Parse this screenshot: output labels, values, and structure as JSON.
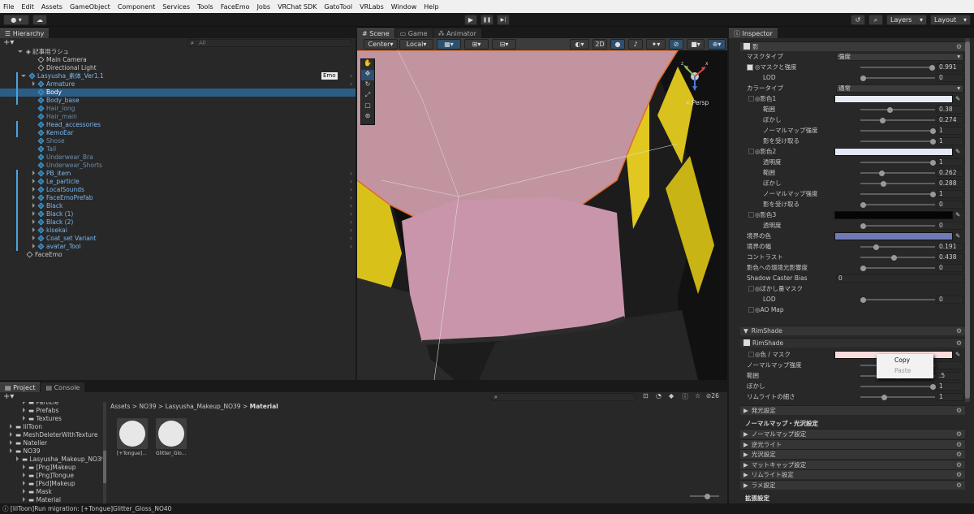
{
  "menu": [
    "File",
    "Edit",
    "Assets",
    "GameObject",
    "Component",
    "Services",
    "Tools",
    "FaceEmo",
    "Jobs",
    "VRChat SDK",
    "GatoTool",
    "VRLabs",
    "Window",
    "Help"
  ],
  "toolbar": {
    "account": "●",
    "layers": "Layers",
    "layout": "Layout",
    "play": "▶",
    "pause": "❚❚",
    "step": "▶|"
  },
  "hierarchy": {
    "tab": "Hierarchy",
    "search_placeholder": "All",
    "scene": "記事用ラシュ",
    "emo_badge": "Emo",
    "items": [
      {
        "label": "Main Camera",
        "indent": 2,
        "style": "normal",
        "icon": "gameobject"
      },
      {
        "label": "Directional Light",
        "indent": 2,
        "style": "normal",
        "icon": "gameobject"
      },
      {
        "label": "Lasyusha_素体_Ver1.1",
        "indent": 1,
        "style": "blue",
        "icon": "prefab",
        "fold": "open"
      },
      {
        "label": "Armature",
        "indent": 2,
        "style": "blue",
        "icon": "prefab",
        "fold": "closed"
      },
      {
        "label": "Body",
        "indent": 2,
        "style": "selected",
        "icon": "prefab"
      },
      {
        "label": "Body_base",
        "indent": 2,
        "style": "blue",
        "icon": "prefab"
      },
      {
        "label": "Hair_long",
        "indent": 2,
        "style": "dim",
        "icon": "prefab"
      },
      {
        "label": "Hair_main",
        "indent": 2,
        "style": "dim",
        "icon": "prefab"
      },
      {
        "label": "Head_accessories",
        "indent": 2,
        "style": "blue",
        "icon": "prefab"
      },
      {
        "label": "KemoEar",
        "indent": 2,
        "style": "blue",
        "icon": "prefab"
      },
      {
        "label": "Shose",
        "indent": 2,
        "style": "dim",
        "icon": "prefab"
      },
      {
        "label": "Tail",
        "indent": 2,
        "style": "dim",
        "icon": "prefab"
      },
      {
        "label": "Underwear_Bra",
        "indent": 2,
        "style": "dim",
        "icon": "prefab"
      },
      {
        "label": "Underwear_Shorts",
        "indent": 2,
        "style": "dim",
        "icon": "prefab"
      },
      {
        "label": "PB_item",
        "indent": 2,
        "style": "blue",
        "icon": "prefab",
        "fold": "closed"
      },
      {
        "label": "Le_particle",
        "indent": 2,
        "style": "blue",
        "icon": "prefab",
        "fold": "closed"
      },
      {
        "label": "LocalSounds",
        "indent": 2,
        "style": "blue",
        "icon": "prefab",
        "fold": "closed"
      },
      {
        "label": "FaceEmoPrefab",
        "indent": 2,
        "style": "blue",
        "icon": "prefab",
        "fold": "closed"
      },
      {
        "label": "Black",
        "indent": 2,
        "style": "blue",
        "icon": "prefab",
        "fold": "closed"
      },
      {
        "label": "Black (1)",
        "indent": 2,
        "style": "blue",
        "icon": "prefab",
        "fold": "closed"
      },
      {
        "label": "Black (2)",
        "indent": 2,
        "style": "blue",
        "icon": "prefab",
        "fold": "closed"
      },
      {
        "label": "kisekai",
        "indent": 2,
        "style": "blue",
        "icon": "prefab",
        "fold": "closed"
      },
      {
        "label": "Coat_set Variant",
        "indent": 2,
        "style": "blue",
        "icon": "prefab",
        "fold": "closed"
      },
      {
        "label": "avatar_Tool",
        "indent": 2,
        "style": "blue",
        "icon": "prefab",
        "fold": "closed"
      },
      {
        "label": "FaceEmo",
        "indent": 1,
        "style": "normal",
        "icon": "gameobject"
      }
    ]
  },
  "scene": {
    "tabs": [
      "Scene",
      "Game",
      "Animator"
    ],
    "pivot": "Center",
    "space": "Local",
    "mode_2d": "2D",
    "persp": "< Persp",
    "gizmo_axes": {
      "x": "x",
      "y": "y",
      "z": "z"
    }
  },
  "project": {
    "tabs": [
      "Project",
      "Console"
    ],
    "breadcrumb": [
      "Assets",
      "NO39",
      "Lasyusha_Makeup_NO39",
      "Material"
    ],
    "hidden_count": "26",
    "tree": [
      {
        "label": "Particle",
        "indent": 3
      },
      {
        "label": "Prefabs",
        "indent": 3
      },
      {
        "label": "Textures",
        "indent": 3
      },
      {
        "label": "lilToon",
        "indent": 1
      },
      {
        "label": "MeshDeleterWithTexture",
        "indent": 1
      },
      {
        "label": "Natelier",
        "indent": 1
      },
      {
        "label": "NO39",
        "indent": 1
      },
      {
        "label": "Lasyusha_Makeup_NO39",
        "indent": 2
      },
      {
        "label": "[Png]Makeup",
        "indent": 3
      },
      {
        "label": "[Png]Tongue",
        "indent": 3
      },
      {
        "label": "[Psd]Makeup",
        "indent": 3
      },
      {
        "label": "Mask",
        "indent": 3
      },
      {
        "label": "Material",
        "indent": 3
      }
    ],
    "assets": [
      "[+Tongue]...",
      "Glitter_Glo..."
    ]
  },
  "status": "[lilToon]Run migration: [+Tongue]Glitter_Gloss_NO40",
  "inspector": {
    "tab": "Inspector",
    "header": "影",
    "rows": [
      {
        "label": "マスクタイプ",
        "type": "dropdown",
        "value": "強度",
        "indent": 0
      },
      {
        "label": "◎マスクと強度",
        "type": "slider",
        "value": "0.991",
        "frac": 0.991,
        "indent": 1,
        "tex": true
      },
      {
        "label": "LOD",
        "type": "slider",
        "value": "0",
        "frac": 0,
        "indent": 2
      },
      {
        "label": "カラータイプ",
        "type": "dropdown",
        "value": "通常",
        "indent": 0
      },
      {
        "label": "◎影色1",
        "type": "color",
        "color": "#e7ebf7",
        "indent": 1
      },
      {
        "label": "範囲",
        "type": "slider",
        "value": "0.38",
        "frac": 0.38,
        "indent": 2
      },
      {
        "label": "ぼかし",
        "type": "slider",
        "value": "0.274",
        "frac": 0.274,
        "indent": 2
      },
      {
        "label": "ノーマルマップ強度",
        "type": "slider",
        "value": "1",
        "frac": 1,
        "indent": 2
      },
      {
        "label": "影を受け取る",
        "type": "slider",
        "value": "1",
        "frac": 1,
        "indent": 2
      },
      {
        "label": "◎影色2",
        "type": "color",
        "color": "#e3e7f8",
        "indent": 1
      },
      {
        "label": "透明度",
        "type": "slider",
        "value": "1",
        "frac": 1,
        "indent": 2
      },
      {
        "label": "範囲",
        "type": "slider",
        "value": "0.262",
        "frac": 0.262,
        "indent": 2
      },
      {
        "label": "ぼかし",
        "type": "slider",
        "value": "0.288",
        "frac": 0.288,
        "indent": 2
      },
      {
        "label": "ノーマルマップ強度",
        "type": "slider",
        "value": "1",
        "frac": 1,
        "indent": 2
      },
      {
        "label": "影を受け取る",
        "type": "slider",
        "value": "0",
        "frac": 0,
        "indent": 2
      },
      {
        "label": "◎影色3",
        "type": "color",
        "color": "#050505",
        "indent": 1
      },
      {
        "label": "透明度",
        "type": "slider",
        "value": "0",
        "frac": 0,
        "indent": 2
      },
      {
        "label": "境界の色",
        "type": "color",
        "color": "#6f7ab5",
        "indent": 0
      },
      {
        "label": "境界の幅",
        "type": "slider",
        "value": "0.191",
        "frac": 0.191,
        "indent": 0
      },
      {
        "label": "コントラスト",
        "type": "slider",
        "value": "0.438",
        "frac": 0.438,
        "indent": 0
      },
      {
        "label": "影色への環境光影響度",
        "type": "slider",
        "value": "0",
        "frac": 0,
        "indent": 0
      },
      {
        "label": "Shadow Caster Bias",
        "type": "field",
        "value": "0",
        "indent": 0
      },
      {
        "label": "◎ぼかし量マスク",
        "type": "none",
        "indent": 1
      },
      {
        "label": "LOD",
        "type": "slider",
        "value": "0",
        "frac": 0,
        "indent": 2
      },
      {
        "label": "◎AO Map",
        "type": "none",
        "indent": 1
      }
    ],
    "rimshade_section": "RimShade",
    "rimshade_toggle": "RimShade",
    "rim_rows": [
      {
        "label": "◎色 / マスク",
        "type": "color",
        "color": "#fbdcdc",
        "indent": 1
      },
      {
        "label": "ノーマルマップ強度",
        "type": "slider",
        "value": "",
        "frac": 0.9,
        "indent": 0
      },
      {
        "label": "範囲",
        "type": "slider",
        "value": ".5",
        "frac": 0.5,
        "indent": 0
      },
      {
        "label": "ぼかし",
        "type": "slider",
        "value": "1",
        "frac": 1,
        "indent": 0
      },
      {
        "label": "リムライトの細さ",
        "type": "slider",
        "value": "1",
        "frac": 0.3,
        "indent": 0
      }
    ],
    "context_menu": {
      "copy": "Copy",
      "paste": "Paste"
    },
    "emission": "発光設定",
    "normal_group": "ノーマルマップ・光沢設定",
    "normal_sections": [
      "ノーマルマップ設定",
      "逆光ライト",
      "光沢設定",
      "マットキャップ設定",
      "リムライト設定",
      "ラメ設定"
    ],
    "extended": "拡張設定"
  }
}
